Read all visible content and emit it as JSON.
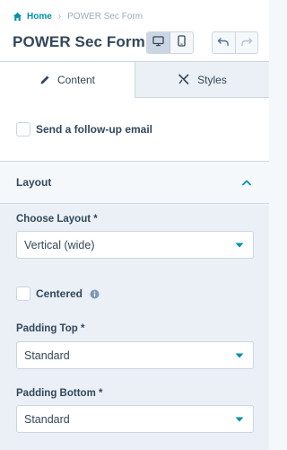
{
  "breadcrumb": {
    "home": "Home",
    "separator": "›",
    "current": "POWER Sec Form"
  },
  "page_title": "POWER Sec Form",
  "device_toggle": {
    "active": "desktop",
    "options": [
      "desktop-icon",
      "mobile-icon"
    ]
  },
  "history": {
    "undo_icon": "undo-icon",
    "redo_icon": "redo-icon"
  },
  "tabs": [
    {
      "label": "Content",
      "icon": "pencil-icon",
      "active": true
    },
    {
      "label": "Styles",
      "icon": "brush-icon",
      "active": false
    }
  ],
  "followup": {
    "label": "Send a follow-up email",
    "checked": false
  },
  "layout_section": {
    "title": "Layout",
    "expanded": true,
    "choose_layout": {
      "label": "Choose Layout *",
      "value": "Vertical (wide)"
    },
    "centered": {
      "label": "Centered",
      "checked": false
    },
    "padding_top": {
      "label": "Padding Top *",
      "value": "Standard"
    },
    "padding_bottom": {
      "label": "Padding Bottom *",
      "value": "Standard"
    }
  },
  "colors": {
    "accent": "#0091ae",
    "text": "#33475b",
    "border": "#cbd6e2",
    "panel": "#eaf0f6"
  }
}
